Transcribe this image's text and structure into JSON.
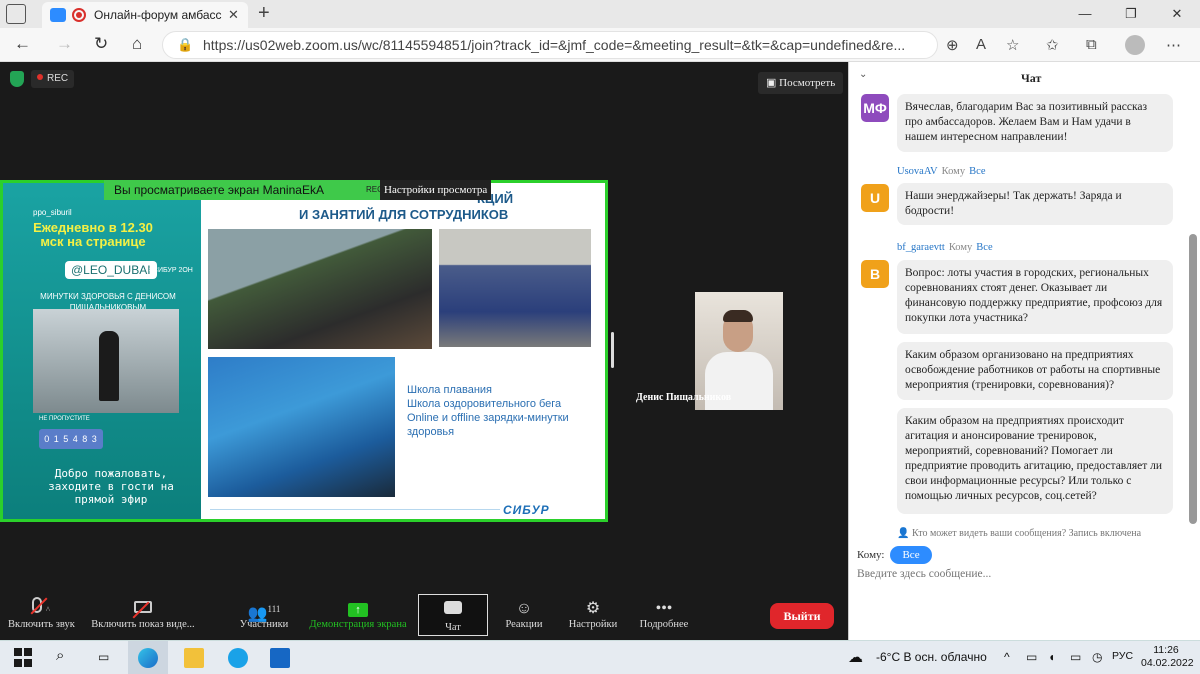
{
  "browser": {
    "tab_title": "Онлайн-форум амбассадо",
    "tab_close": "✕",
    "new_tab": "+",
    "url": "https://us02web.zoom.us/wc/81145594851/join?track_id=&jmf_code=&meeting_result=&tk=&cap=undefined&re...",
    "window_controls": [
      "—",
      "❐",
      "✕"
    ]
  },
  "meeting": {
    "rec_label": "REC",
    "view_button": "Посмотреть",
    "viewing_banner": "Вы просматриваете экран ManinaEkA",
    "rec_mini": "REC",
    "view_settings": "Настройки просмотра",
    "participant_name": "Денис Пищальников",
    "slide": {
      "title_line1": "КЦИЙ",
      "title_line2": "И ЗАНЯТИЙ ДЛЯ СОТРУДНИКОВ",
      "bullets": [
        "Школа плавания",
        "Школа оздоровительного бега",
        "Online и offline зарядки-минутки",
        "здоровья"
      ],
      "logo": "СИБУР",
      "story": {
        "account": "ppo_siburil",
        "daily": "Ежедневно в 12.30 мск на странице",
        "handle": "@LEO_DUBAI",
        "tag": "#СИБУР 2ОН",
        "minutes": "МИНУТКИ ЗДОРОВЬЯ С ДЕНИСОМ ПИЩАЛЬНИКОВЫМ",
        "timer_label": "НЕ ПРОПУСТИТЕ",
        "timer": "0 1 5 4 8 3",
        "welcome": "Добро пожаловать, заходите в гости на прямой эфир"
      }
    }
  },
  "toolbar": {
    "mic": "Включить звук",
    "video": "Включить показ виде...",
    "participants": "Участники",
    "participants_count": "111",
    "share": "Демонстрация экрана",
    "chat": "Чат",
    "reactions": "Реакции",
    "settings": "Настройки",
    "more": "Подробнее",
    "leave": "Выйти"
  },
  "chat": {
    "title": "Чат",
    "messages": [
      {
        "avatar": "МФ",
        "color": "#8e4bbd",
        "text": "Вячеслав, благодарим Вас за позитивный рассказ про амбассадоров. Желаем Вам и Нам удачи в нашем интересном направлении!"
      },
      {
        "sender": "UsovaAV",
        "to": "Кому",
        "all": "Все",
        "avatar": "U",
        "color": "#f0a11a",
        "text": "Наши энерджайзеры! Так держать! Заряда и бодрости!"
      },
      {
        "sender": "bf_garaevtt",
        "to": "Кому",
        "all": "Все",
        "avatar": "B",
        "color": "#f0a11a",
        "text": "Вопрос: лоты участия в городских, региональных соревнованиях стоят денег. Оказывает ли финансовую поддержку предприятие, профсоюз для покупки лота участника?"
      },
      {
        "text": "Каким образом организовано на предприятиях освобождение работников от работы на спортивные мероприятия (тренировки, соревнования)?"
      },
      {
        "text": "Каким образом на предприятиях происходит агитация и анонсирование тренировок, мероприятий, соревнований? Помогает ли предприятие проводить агитацию, предоставляет ли свои информационные ресурсы? Или только с помощью личных ресурсов, соц.сетей?"
      }
    ],
    "who_can_see": "Кто может видеть ваши сообщения? Запись включена",
    "to_label": "Кому:",
    "to_value": "Все",
    "input_placeholder": "Введите здесь сообщение..."
  },
  "taskbar": {
    "weather": "-6°C  В осн. облачно",
    "lang": "РУС",
    "time": "11:26",
    "date": "04.02.2022"
  }
}
